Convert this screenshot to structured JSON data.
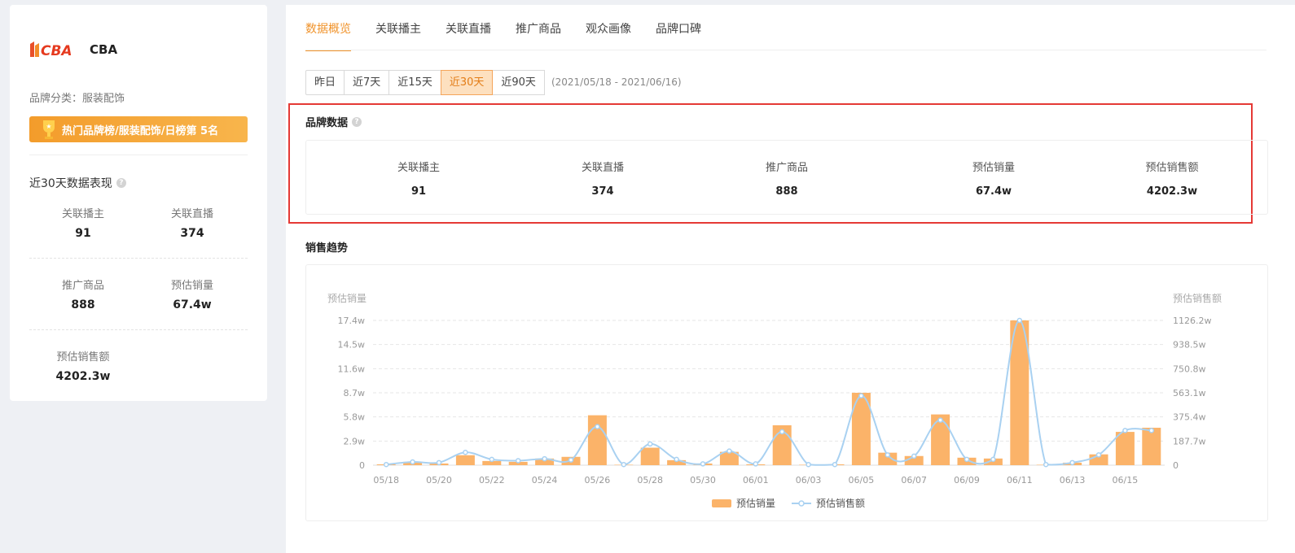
{
  "sidebar": {
    "brand_name": "CBA",
    "category_label": "品牌分类：",
    "category_value": "服装配饰",
    "rank_text": "热门品牌榜/服装配饰/日榜第 5名",
    "perf_title": "近30天数据表现",
    "stats": [
      {
        "label": "关联播主",
        "value": "91"
      },
      {
        "label": "关联直播",
        "value": "374"
      },
      {
        "label": "推广商品",
        "value": "888"
      },
      {
        "label": "预估销量",
        "value": "67.4w"
      },
      {
        "label": "预估销售额",
        "value": "4202.3w"
      }
    ]
  },
  "tabs": [
    "数据概览",
    "关联播主",
    "关联直播",
    "推广商品",
    "观众画像",
    "品牌口碑"
  ],
  "ranges": [
    "昨日",
    "近7天",
    "近15天",
    "近30天",
    "近90天"
  ],
  "active_range": "近30天",
  "date_range": "(2021/05/18 - 2021/06/16)",
  "brand_data": {
    "title": "品牌数据",
    "stats": [
      {
        "label": "关联播主",
        "value": "91"
      },
      {
        "label": "关联直播",
        "value": "374"
      },
      {
        "label": "推广商品",
        "value": "888"
      },
      {
        "label": "预估销量",
        "value": "67.4w"
      },
      {
        "label": "预估销售额",
        "value": "4202.3w"
      }
    ]
  },
  "trend_title": "销售趋势",
  "colors": {
    "accent": "#f0932b",
    "bar": "#fbb369",
    "line": "#a9d1f1",
    "highlight": "#e53935"
  },
  "chart_data": {
    "type": "bar",
    "ylabel": "预估销量",
    "y2label": "预估销售额",
    "yticks": [
      "0",
      "2.9w",
      "5.8w",
      "8.7w",
      "11.6w",
      "14.5w",
      "17.4w"
    ],
    "y2ticks": [
      "0",
      "187.7w",
      "375.4w",
      "563.1w",
      "750.8w",
      "938.5w",
      "1126.2w"
    ],
    "ylim": [
      0,
      17.4
    ],
    "y2lim": [
      0,
      1126.2
    ],
    "categories": [
      "05/18",
      "05/19",
      "05/20",
      "05/21",
      "05/22",
      "05/23",
      "05/24",
      "05/25",
      "05/26",
      "05/27",
      "05/28",
      "05/29",
      "05/30",
      "05/31",
      "06/01",
      "06/02",
      "06/03",
      "06/04",
      "06/05",
      "06/06",
      "06/07",
      "06/08",
      "06/09",
      "06/10",
      "06/11",
      "06/12",
      "06/13",
      "06/14",
      "06/15",
      "06/16"
    ],
    "xtick_labels": [
      "05/18",
      "05/20",
      "05/22",
      "05/24",
      "05/26",
      "05/28",
      "05/30",
      "06/01",
      "06/03",
      "06/05",
      "06/07",
      "06/09",
      "06/11",
      "06/13",
      "06/15"
    ],
    "series": [
      {
        "name": "预估销量",
        "kind": "bar",
        "values": [
          0.1,
          0.4,
          0.2,
          1.2,
          0.5,
          0.4,
          0.8,
          1.0,
          6.0,
          0.05,
          2.1,
          0.6,
          0.2,
          1.6,
          0.1,
          4.8,
          0.05,
          0.1,
          8.7,
          1.5,
          1.1,
          6.1,
          0.9,
          0.8,
          17.4,
          0.05,
          0.3,
          1.3,
          4.0,
          4.5
        ]
      },
      {
        "name": "预估销售额",
        "kind": "line",
        "values": [
          5,
          25,
          20,
          100,
          45,
          35,
          50,
          40,
          300,
          5,
          165,
          45,
          10,
          110,
          10,
          260,
          5,
          5,
          540,
          80,
          70,
          350,
          45,
          45,
          1126,
          5,
          20,
          80,
          270,
          270
        ]
      }
    ],
    "legend": "bottom"
  }
}
